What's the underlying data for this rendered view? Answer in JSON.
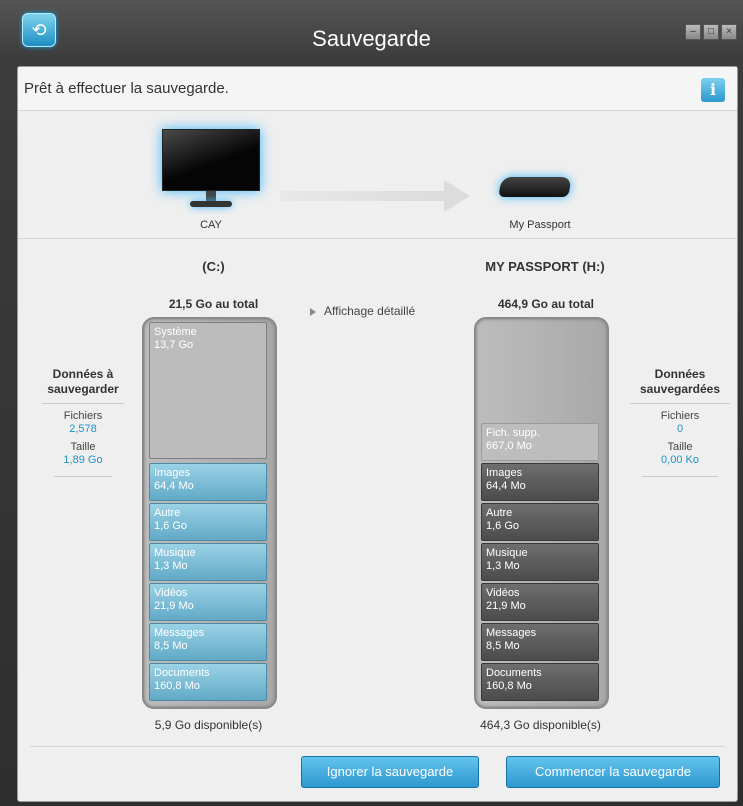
{
  "window": {
    "title": "Sauvegarde"
  },
  "status": {
    "text": "Prêt à effectuer la sauvegarde."
  },
  "devices": {
    "source_label": "CAY",
    "target_label": "My Passport"
  },
  "source": {
    "drive_name": "(C:)",
    "total": "21,5 Go au total",
    "available": "5,9 Go disponible(s)",
    "system": {
      "label": "Système",
      "size": "13,7 Go"
    },
    "categories": [
      {
        "label": "Images",
        "size": "64,4 Mo"
      },
      {
        "label": "Autre",
        "size": "1,6 Go"
      },
      {
        "label": "Musique",
        "size": "1,3 Mo"
      },
      {
        "label": "Vidéos",
        "size": "21,9 Mo"
      },
      {
        "label": "Messages",
        "size": "8,5 Mo"
      },
      {
        "label": "Documents",
        "size": "160,8 Mo"
      }
    ]
  },
  "target": {
    "drive_name": "MY PASSPORT (H:)",
    "total": "464,9 Go au total",
    "available": "464,3 Go disponible(s)",
    "extra": {
      "label": "Fich. supp.",
      "size": "667,0 Mo"
    },
    "categories": [
      {
        "label": "Images",
        "size": "64,4 Mo"
      },
      {
        "label": "Autre",
        "size": "1,6 Go"
      },
      {
        "label": "Musique",
        "size": "1,3 Mo"
      },
      {
        "label": "Vidéos",
        "size": "21,9 Mo"
      },
      {
        "label": "Messages",
        "size": "8,5 Mo"
      },
      {
        "label": "Documents",
        "size": "160,8 Mo"
      }
    ]
  },
  "detail_toggle": "Affichage détaillé",
  "left_stats": {
    "heading_1": "Données à",
    "heading_2": "sauvegarder",
    "files_label": "Fichiers",
    "files_value": "2,578",
    "size_label": "Taille",
    "size_value": "1,89 Go"
  },
  "right_stats": {
    "heading_1": "Données",
    "heading_2": "sauvegardées",
    "files_label": "Fichiers",
    "files_value": "0",
    "size_label": "Taille",
    "size_value": "0,00 Ko"
  },
  "buttons": {
    "skip": "Ignorer la sauvegarde",
    "start": "Commencer la sauvegarde"
  },
  "icons": {
    "app": "backup-app-icon",
    "info": "info-icon"
  }
}
